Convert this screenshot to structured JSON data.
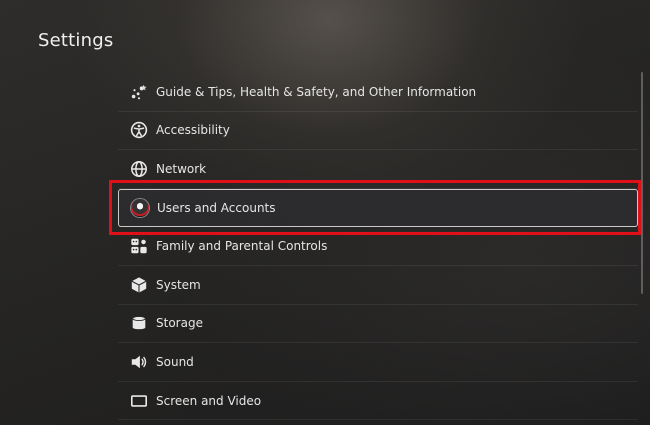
{
  "header": {
    "title": "Settings"
  },
  "menu": {
    "items": [
      {
        "label": "Guide & Tips, Health & Safety, and Other Information",
        "icon": "tips-icon"
      },
      {
        "label": "Accessibility",
        "icon": "accessibility-icon"
      },
      {
        "label": "Network",
        "icon": "globe-icon"
      },
      {
        "label": "Users and Accounts",
        "icon": "user-avatar-icon",
        "selected": true
      },
      {
        "label": "Family and Parental Controls",
        "icon": "family-icon"
      },
      {
        "label": "System",
        "icon": "cube-icon"
      },
      {
        "label": "Storage",
        "icon": "storage-icon"
      },
      {
        "label": "Sound",
        "icon": "speaker-icon"
      },
      {
        "label": "Screen and Video",
        "icon": "screen-icon"
      }
    ]
  },
  "colors": {
    "highlight": "#e0101a",
    "text": "#e6e6e6"
  }
}
